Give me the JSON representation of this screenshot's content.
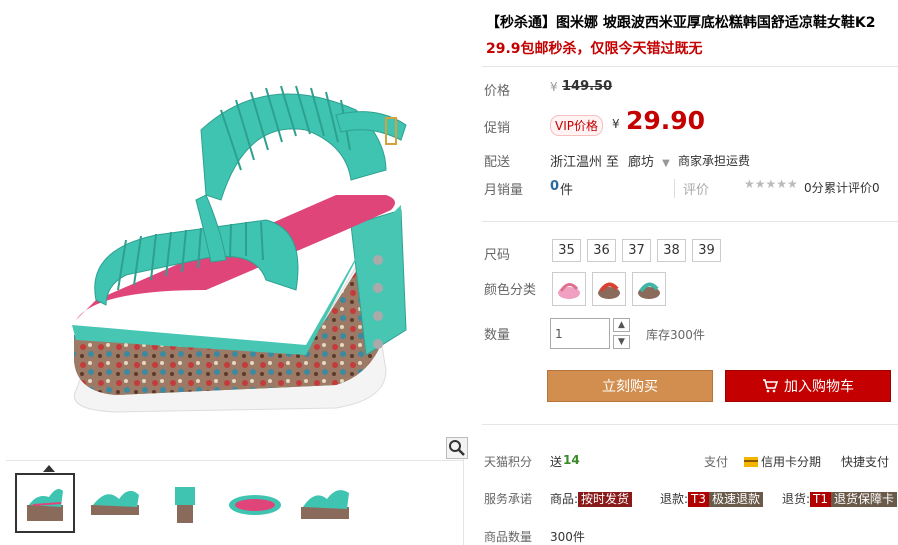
{
  "product": {
    "title": "【秒杀通】图米娜 坡跟波西米亚厚底松糕韩国舒适凉鞋女鞋K2",
    "subtitle": "29.9包邮秒杀，仅限今天错过既无"
  },
  "price": {
    "label": "价格",
    "currency": "¥",
    "original": "149.50",
    "promo_label": "促销",
    "vip_badge": "VIP价格",
    "promo_currency": "¥",
    "promo_value": "29.90"
  },
  "shipping": {
    "label": "配送",
    "from": "浙江温州",
    "to_word": "至",
    "destination": "廊坊",
    "fee": "商家承担运费"
  },
  "sales": {
    "label": "月销量",
    "count": "0",
    "unit": "件",
    "rating_label": "评价",
    "rating_stars": "★★★★★",
    "rating_score": "0分",
    "review_text": "累计评价",
    "review_count": "0"
  },
  "options": {
    "size_label": "尺码",
    "sizes": [
      "35",
      "36",
      "37",
      "38",
      "39"
    ],
    "color_label": "颜色分类",
    "colors": [
      {
        "name": "pink",
        "hex": "#f0a0c0"
      },
      {
        "name": "red",
        "hex": "#d94030"
      },
      {
        "name": "teal",
        "hex": "#3fb5a6"
      }
    ],
    "qty_label": "数量",
    "qty_value": "1",
    "stock": "库存300件"
  },
  "actions": {
    "buy_now": "立刻购买",
    "cart_icon": "cart-icon",
    "add_to_cart": "加入购物车"
  },
  "footer": {
    "points_label": "天猫积分",
    "points_prefix": "送",
    "points_value": "14",
    "pay_label": "支付",
    "credit_icon": "credit-card-icon",
    "credit": "信用卡分期",
    "quick_pay": "快捷支付",
    "service_label": "服务承诺",
    "svc1_prefix": "商品:",
    "svc1_tag": "按时发货",
    "svc2_prefix": "退款:",
    "svc2_code": "T3",
    "svc2_tag": "极速退款",
    "svc3_prefix": "退货:",
    "svc3_code": "T1",
    "svc3_tag": "退货保障卡",
    "stock_label": "商品数量",
    "stock_value": "300件"
  },
  "colors": {
    "accent_red": "#c40000",
    "buy_orange": "#d18e4e",
    "teal_product": "#3fc4b2",
    "points_green": "#3a8a2a",
    "sales_blue": "#2b6aa0"
  },
  "icons": [
    "zoom-icon",
    "cart-icon",
    "credit-card-icon",
    "chevron-down-icon",
    "up-arrow-icon",
    "down-arrow-icon"
  ]
}
